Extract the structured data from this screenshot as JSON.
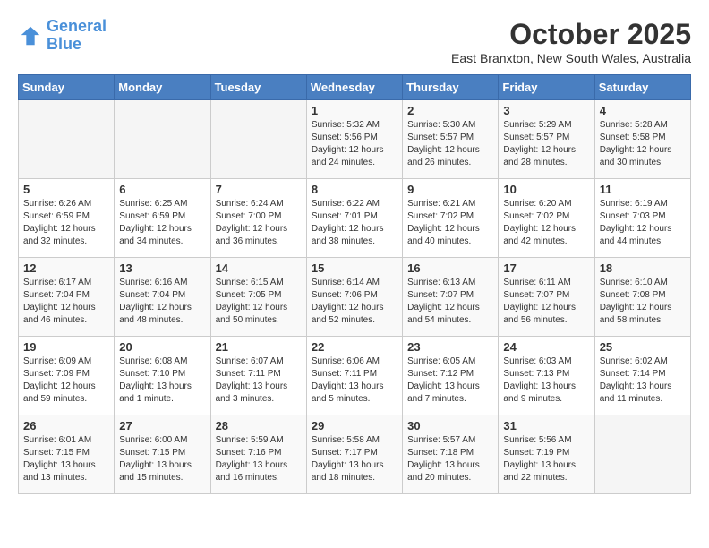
{
  "header": {
    "logo": {
      "line1": "General",
      "line2": "Blue"
    },
    "title": "October 2025",
    "location": "East Branxton, New South Wales, Australia"
  },
  "weekdays": [
    "Sunday",
    "Monday",
    "Tuesday",
    "Wednesday",
    "Thursday",
    "Friday",
    "Saturday"
  ],
  "weeks": [
    [
      {
        "day": "",
        "content": ""
      },
      {
        "day": "",
        "content": ""
      },
      {
        "day": "",
        "content": ""
      },
      {
        "day": "1",
        "content": "Sunrise: 5:32 AM\nSunset: 5:56 PM\nDaylight: 12 hours\nand 24 minutes."
      },
      {
        "day": "2",
        "content": "Sunrise: 5:30 AM\nSunset: 5:57 PM\nDaylight: 12 hours\nand 26 minutes."
      },
      {
        "day": "3",
        "content": "Sunrise: 5:29 AM\nSunset: 5:57 PM\nDaylight: 12 hours\nand 28 minutes."
      },
      {
        "day": "4",
        "content": "Sunrise: 5:28 AM\nSunset: 5:58 PM\nDaylight: 12 hours\nand 30 minutes."
      }
    ],
    [
      {
        "day": "5",
        "content": "Sunrise: 6:26 AM\nSunset: 6:59 PM\nDaylight: 12 hours\nand 32 minutes."
      },
      {
        "day": "6",
        "content": "Sunrise: 6:25 AM\nSunset: 6:59 PM\nDaylight: 12 hours\nand 34 minutes."
      },
      {
        "day": "7",
        "content": "Sunrise: 6:24 AM\nSunset: 7:00 PM\nDaylight: 12 hours\nand 36 minutes."
      },
      {
        "day": "8",
        "content": "Sunrise: 6:22 AM\nSunset: 7:01 PM\nDaylight: 12 hours\nand 38 minutes."
      },
      {
        "day": "9",
        "content": "Sunrise: 6:21 AM\nSunset: 7:02 PM\nDaylight: 12 hours\nand 40 minutes."
      },
      {
        "day": "10",
        "content": "Sunrise: 6:20 AM\nSunset: 7:02 PM\nDaylight: 12 hours\nand 42 minutes."
      },
      {
        "day": "11",
        "content": "Sunrise: 6:19 AM\nSunset: 7:03 PM\nDaylight: 12 hours\nand 44 minutes."
      }
    ],
    [
      {
        "day": "12",
        "content": "Sunrise: 6:17 AM\nSunset: 7:04 PM\nDaylight: 12 hours\nand 46 minutes."
      },
      {
        "day": "13",
        "content": "Sunrise: 6:16 AM\nSunset: 7:04 PM\nDaylight: 12 hours\nand 48 minutes."
      },
      {
        "day": "14",
        "content": "Sunrise: 6:15 AM\nSunset: 7:05 PM\nDaylight: 12 hours\nand 50 minutes."
      },
      {
        "day": "15",
        "content": "Sunrise: 6:14 AM\nSunset: 7:06 PM\nDaylight: 12 hours\nand 52 minutes."
      },
      {
        "day": "16",
        "content": "Sunrise: 6:13 AM\nSunset: 7:07 PM\nDaylight: 12 hours\nand 54 minutes."
      },
      {
        "day": "17",
        "content": "Sunrise: 6:11 AM\nSunset: 7:07 PM\nDaylight: 12 hours\nand 56 minutes."
      },
      {
        "day": "18",
        "content": "Sunrise: 6:10 AM\nSunset: 7:08 PM\nDaylight: 12 hours\nand 58 minutes."
      }
    ],
    [
      {
        "day": "19",
        "content": "Sunrise: 6:09 AM\nSunset: 7:09 PM\nDaylight: 12 hours\nand 59 minutes."
      },
      {
        "day": "20",
        "content": "Sunrise: 6:08 AM\nSunset: 7:10 PM\nDaylight: 13 hours\nand 1 minute."
      },
      {
        "day": "21",
        "content": "Sunrise: 6:07 AM\nSunset: 7:11 PM\nDaylight: 13 hours\nand 3 minutes."
      },
      {
        "day": "22",
        "content": "Sunrise: 6:06 AM\nSunset: 7:11 PM\nDaylight: 13 hours\nand 5 minutes."
      },
      {
        "day": "23",
        "content": "Sunrise: 6:05 AM\nSunset: 7:12 PM\nDaylight: 13 hours\nand 7 minutes."
      },
      {
        "day": "24",
        "content": "Sunrise: 6:03 AM\nSunset: 7:13 PM\nDaylight: 13 hours\nand 9 minutes."
      },
      {
        "day": "25",
        "content": "Sunrise: 6:02 AM\nSunset: 7:14 PM\nDaylight: 13 hours\nand 11 minutes."
      }
    ],
    [
      {
        "day": "26",
        "content": "Sunrise: 6:01 AM\nSunset: 7:15 PM\nDaylight: 13 hours\nand 13 minutes."
      },
      {
        "day": "27",
        "content": "Sunrise: 6:00 AM\nSunset: 7:15 PM\nDaylight: 13 hours\nand 15 minutes."
      },
      {
        "day": "28",
        "content": "Sunrise: 5:59 AM\nSunset: 7:16 PM\nDaylight: 13 hours\nand 16 minutes."
      },
      {
        "day": "29",
        "content": "Sunrise: 5:58 AM\nSunset: 7:17 PM\nDaylight: 13 hours\nand 18 minutes."
      },
      {
        "day": "30",
        "content": "Sunrise: 5:57 AM\nSunset: 7:18 PM\nDaylight: 13 hours\nand 20 minutes."
      },
      {
        "day": "31",
        "content": "Sunrise: 5:56 AM\nSunset: 7:19 PM\nDaylight: 13 hours\nand 22 minutes."
      },
      {
        "day": "",
        "content": ""
      }
    ]
  ]
}
